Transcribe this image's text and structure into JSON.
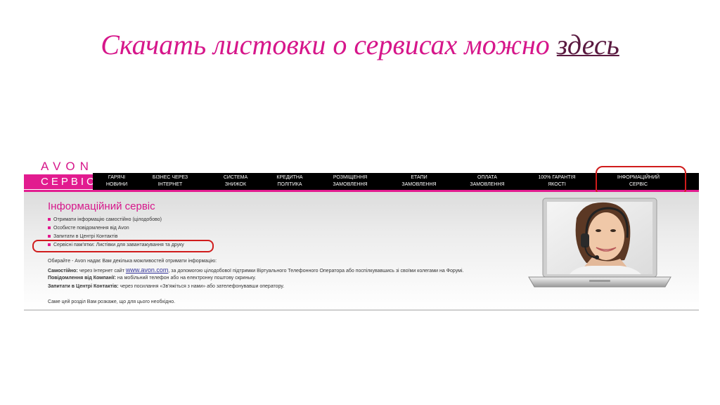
{
  "slide": {
    "title_text": "Скачать листовки о сервисах можно ",
    "title_link": "здесь"
  },
  "brand": {
    "line1": "AVON",
    "line2": "СЕРВІС"
  },
  "nav": [
    {
      "line1": "Гарячі",
      "line2": "новини"
    },
    {
      "line1": "Бізнес через",
      "line2": "інтернет"
    },
    {
      "line1": "Система",
      "line2": "знижок"
    },
    {
      "line1": "Кредитна",
      "line2": "політика"
    },
    {
      "line1": "Розміщення",
      "line2": "замовлення"
    },
    {
      "line1": "Етапи",
      "line2": "замовлення"
    },
    {
      "line1": "Оплата",
      "line2": "замовлення"
    },
    {
      "line1": "100% гарантія",
      "line2": "якості"
    },
    {
      "line1": "Інформаційний",
      "line2": "сервіс"
    }
  ],
  "info": {
    "title": "Інформаційний сервіс",
    "bullets": [
      "Отримати інформацію самостійно (цілодобово)",
      "Особисте повідомлення від Avon",
      "Запитати в Центрі Контактів",
      "Сервісні пам'ятки: Листівки для завантажування та друку"
    ],
    "intro": "Обирайте - Avon надає Вам декілька можливостей отримати інформацію:",
    "line1_bold": "Самостійно:",
    "line1_pre": " через Інтернет сайт ",
    "line1_link": "www.avon.com",
    "line1_post": ", за допомогою цілодобової підтримки Віртуального Телефонного  Оператора або поспілкувавшись зі своїми колегами на Форумі.",
    "line2_bold": "Повідомлення від Компанії:",
    "line2_text": " на мобільний телефон або на електронну поштову скриньку.",
    "line3_bold": "Запитати в Центрі Контактів:",
    "line3_text": " через посилання «Зв'яжіться з нами» або зателефонувавши оператору.",
    "footer": "Саме цей розділ Вам розкаже, що для цього необхідно."
  }
}
